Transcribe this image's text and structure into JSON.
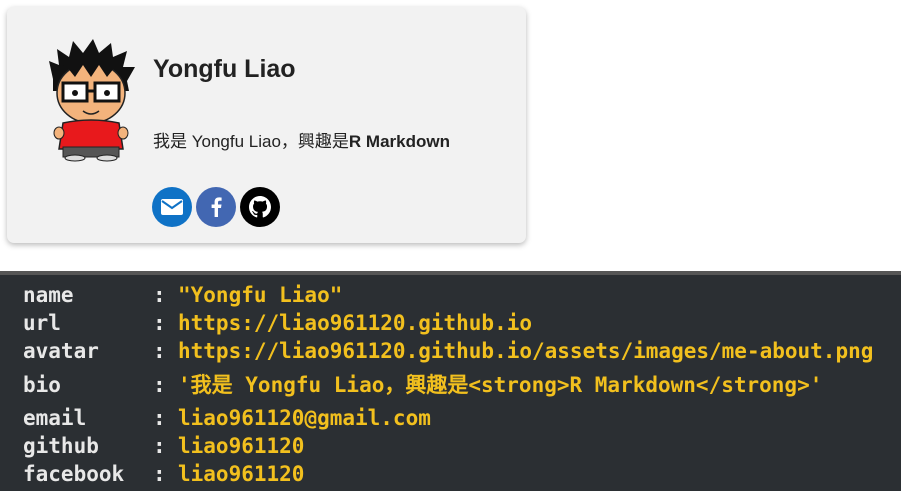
{
  "card": {
    "name": "Yongfu Liao",
    "bio_plain": "我是 Yongfu Liao，興趣是",
    "bio_strong": "R Markdown",
    "avatar_icon": "cartoon-avatar",
    "social": [
      {
        "icon": "envelope-icon",
        "color": "#0f72c6"
      },
      {
        "icon": "facebook-icon",
        "color": "#4267b2"
      },
      {
        "icon": "github-icon",
        "color": "#000000"
      }
    ]
  },
  "terminal": {
    "rows": [
      {
        "key": "name",
        "colon": ":",
        "value": "\"Yongfu Liao\""
      },
      {
        "key": "url",
        "colon": ":",
        "value": "https://liao961120.github.io"
      },
      {
        "key": "avatar",
        "colon": ":",
        "value": "https://liao961120.github.io/assets/images/me-about.png"
      },
      {
        "key": "bio",
        "colon": ":",
        "value": "'我是 Yongfu Liao，興趣是<strong>R Markdown</strong>'"
      },
      {
        "key": "email",
        "colon": ":",
        "value": "liao961120@gmail.com"
      },
      {
        "key": "github",
        "colon": ":",
        "value": "liao961120"
      },
      {
        "key": "facebook",
        "colon": ":",
        "value": "liao961120"
      }
    ]
  }
}
